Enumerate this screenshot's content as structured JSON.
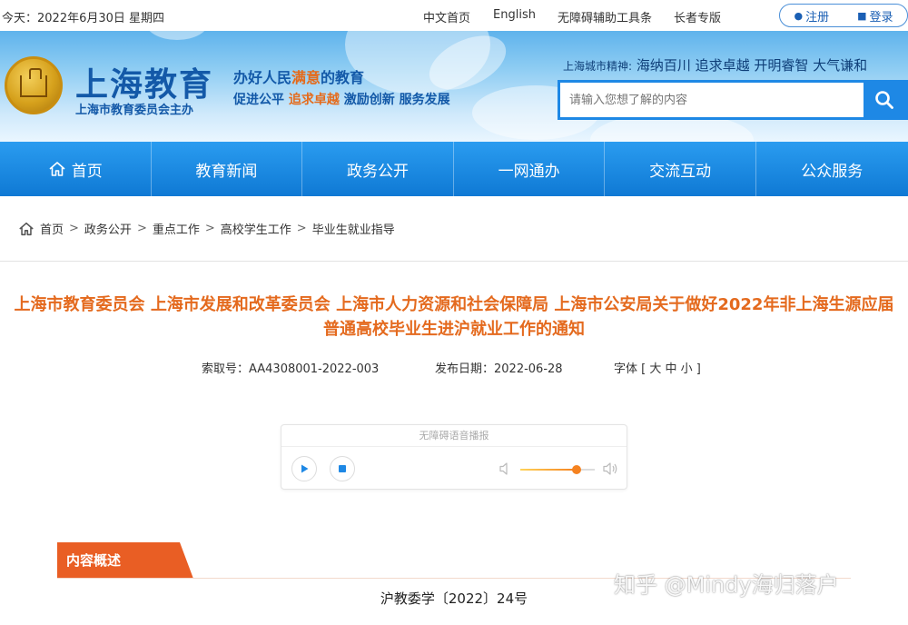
{
  "topbar": {
    "date": "今天：2022年6月30日 星期四",
    "links": [
      "中文首页",
      "English",
      "无障碍辅助工具条",
      "长者专版"
    ],
    "register": "注册",
    "login": "登录"
  },
  "header": {
    "logo_title": "上海教育",
    "logo_sub": "上海市教育委员会主办",
    "slogan_line1_a": "办好人民",
    "slogan_line1_b": "满意",
    "slogan_line1_c": "的教育",
    "slogan_line2_a": "促进公平 ",
    "slogan_line2_b": "追求卓越",
    "slogan_line2_c": " 激励创新 服务发展",
    "spirit_label": "上海城市精神:",
    "spirit_text": " 海纳百川 追求卓越 开明睿智 大气谦和",
    "search_placeholder": "请输入您想了解的内容"
  },
  "nav": [
    "首页",
    "教育新闻",
    "政务公开",
    "一网通办",
    "交流互动",
    "公众服务"
  ],
  "breadcrumb": [
    "首页",
    "政务公开",
    "重点工作",
    "高校学生工作",
    "毕业生就业指导"
  ],
  "article": {
    "title": "上海市教育委员会 上海市发展和改革委员会 上海市人力资源和社会保障局 上海市公安局关于做好2022年非上海生源应届普通高校毕业生进沪就业工作的通知",
    "index_no": "索取号：AA4308001-2022-003",
    "publish_date": "发布日期：2022-06-28",
    "font_size": "字体 [ 大 中 小 ]"
  },
  "player": {
    "title": "无障碍语音播报",
    "volume": 0.76
  },
  "content": {
    "tag": "内容概述",
    "doc_no": "沪教委学〔2022〕24号"
  },
  "watermark": "知乎 @Mindy海归落户",
  "colors": {
    "brand_blue": "#1359a8",
    "nav_blue": "#1a8ae6",
    "accent_orange": "#e46a1e"
  }
}
